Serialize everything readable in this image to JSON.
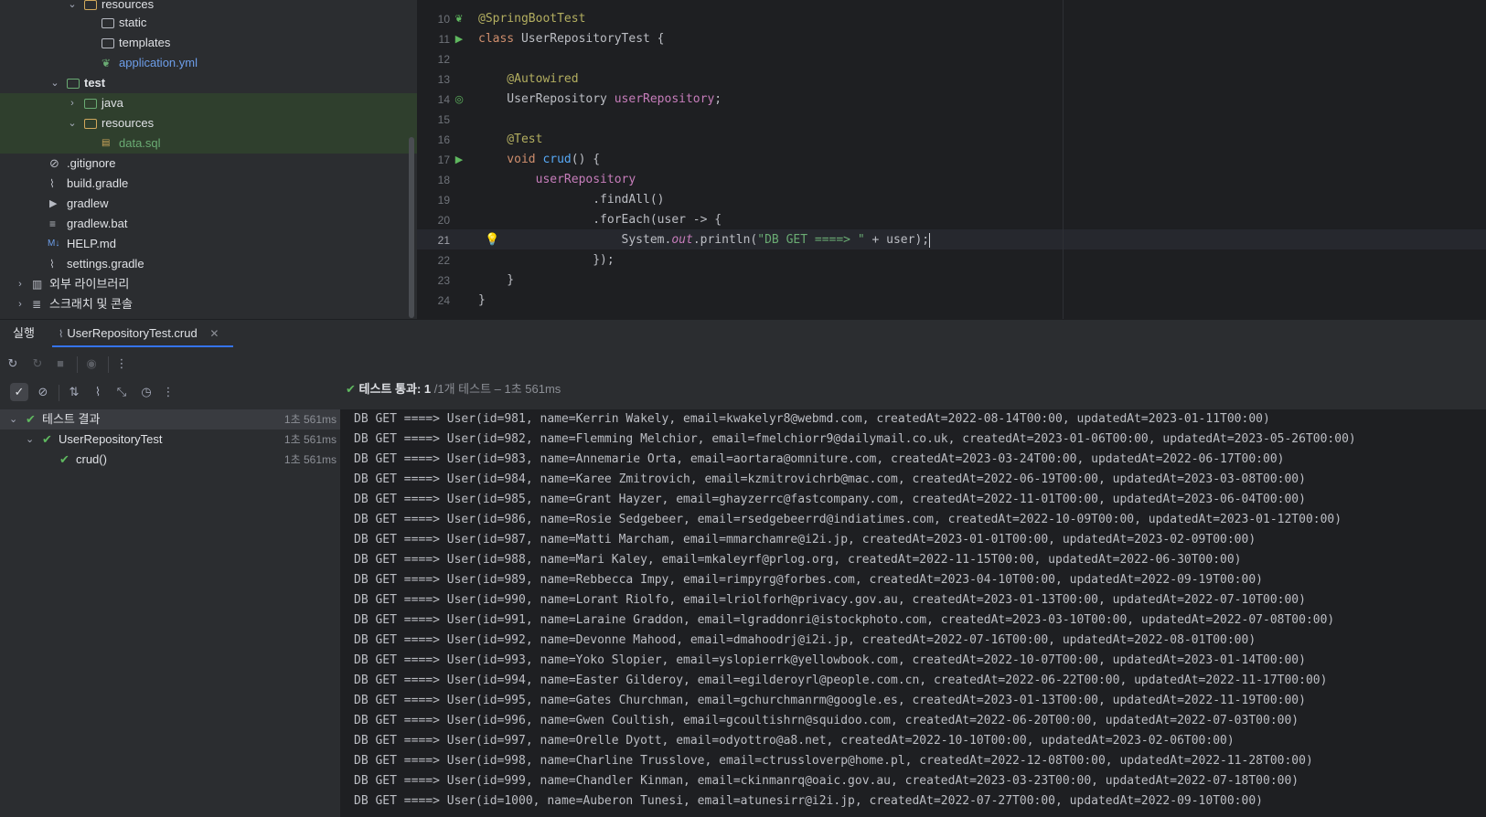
{
  "project_tree": {
    "items": [
      {
        "label": "resources",
        "icon": "resources-folder-icon",
        "arrow": "expanded"
      },
      {
        "label": "static",
        "icon": "folder-icon",
        "arrow": ""
      },
      {
        "label": "templates",
        "icon": "folder-icon",
        "arrow": ""
      },
      {
        "label": "application.yml",
        "icon": "spring-config-file-icon",
        "arrow": ""
      },
      {
        "label": "test",
        "icon": "test-source-folder-icon",
        "arrow": "expanded"
      },
      {
        "label": "java",
        "icon": "folder-icon",
        "arrow": "collapsed"
      },
      {
        "label": "resources",
        "icon": "resources-folder-icon",
        "arrow": "expanded"
      },
      {
        "label": "data.sql",
        "icon": "sql-file-icon",
        "arrow": ""
      },
      {
        "label": ".gitignore",
        "icon": "gitignore-file-icon",
        "arrow": ""
      },
      {
        "label": "build.gradle",
        "icon": "gradle-file-icon",
        "arrow": ""
      },
      {
        "label": "gradlew",
        "icon": "script-file-icon",
        "arrow": ""
      },
      {
        "label": "gradlew.bat",
        "icon": "text-file-icon",
        "arrow": ""
      },
      {
        "label": "HELP.md",
        "icon": "markdown-file-icon",
        "arrow": ""
      },
      {
        "label": "settings.gradle",
        "icon": "gradle-file-icon",
        "arrow": ""
      },
      {
        "label": "외부 라이브러리",
        "icon": "library-icon",
        "arrow": "collapsed"
      },
      {
        "label": "스크래치 및 콘솔",
        "icon": "scratches-icon",
        "arrow": "collapsed"
      }
    ]
  },
  "editor": {
    "line_numbers": [
      "10",
      "11",
      "12",
      "13",
      "14",
      "15",
      "16",
      "17",
      "18",
      "19",
      "20",
      "21",
      "22",
      "23",
      "24"
    ],
    "code": {
      "l10": "@SpringBootTest",
      "l11_kw": "class",
      "l11_rest": " UserRepositoryTest {",
      "l13": "    @Autowired",
      "l14_type": "    UserRepository ",
      "l14_field": "userRepository",
      "l14_end": ";",
      "l16": "    @Test",
      "l17_kw": "    void",
      "l17_fn": " crud",
      "l17_rest": "() {",
      "l18": "        userRepository",
      "l19": "                .findAll()",
      "l20": "                .forEach(user -> {",
      "l21_a": "                    System.",
      "l21_out": "out",
      "l21_b": ".println(",
      "l21_str": "\"DB GET ====> \"",
      "l21_c": " + user);",
      "l22": "                });",
      "l23": "    }",
      "l24": "}"
    }
  },
  "run_window": {
    "tab_run": "실행",
    "tab_config": "UserRepositoryTest.crud",
    "status_pass": "테스트 통과: 1",
    "status_rest": " /1개 테스트 – 1초 561ms",
    "results": [
      {
        "label": "테스트 결과",
        "duration": "1초 561ms"
      },
      {
        "label": "UserRepositoryTest",
        "duration": "1초 561ms"
      },
      {
        "label": "crud()",
        "duration": "1초 561ms"
      }
    ],
    "console": [
      "DB GET ====> User(id=981, name=Kerrin Wakely, email=kwakelyr8@webmd.com, createdAt=2022-08-14T00:00, updatedAt=2023-01-11T00:00)",
      "DB GET ====> User(id=982, name=Flemming Melchior, email=fmelchiorr9@dailymail.co.uk, createdAt=2023-01-06T00:00, updatedAt=2023-05-26T00:00)",
      "DB GET ====> User(id=983, name=Annemarie Orta, email=aortara@omniture.com, createdAt=2023-03-24T00:00, updatedAt=2022-06-17T00:00)",
      "DB GET ====> User(id=984, name=Karee Zmitrovich, email=kzmitrovichrb@mac.com, createdAt=2022-06-19T00:00, updatedAt=2023-03-08T00:00)",
      "DB GET ====> User(id=985, name=Grant Hayzer, email=ghayzerrc@fastcompany.com, createdAt=2022-11-01T00:00, updatedAt=2023-06-04T00:00)",
      "DB GET ====> User(id=986, name=Rosie Sedgebeer, email=rsedgebeerrd@indiatimes.com, createdAt=2022-10-09T00:00, updatedAt=2023-01-12T00:00)",
      "DB GET ====> User(id=987, name=Matti Marcham, email=mmarchamre@i2i.jp, createdAt=2023-01-01T00:00, updatedAt=2023-02-09T00:00)",
      "DB GET ====> User(id=988, name=Mari Kaley, email=mkaleyrf@prlog.org, createdAt=2022-11-15T00:00, updatedAt=2022-06-30T00:00)",
      "DB GET ====> User(id=989, name=Rebbecca Impy, email=rimpyrg@forbes.com, createdAt=2023-04-10T00:00, updatedAt=2022-09-19T00:00)",
      "DB GET ====> User(id=990, name=Lorant Riolfo, email=lriolforh@privacy.gov.au, createdAt=2023-01-13T00:00, updatedAt=2022-07-10T00:00)",
      "DB GET ====> User(id=991, name=Laraine Graddon, email=lgraddonri@istockphoto.com, createdAt=2023-03-10T00:00, updatedAt=2022-07-08T00:00)",
      "DB GET ====> User(id=992, name=Devonne Mahood, email=dmahoodrj@i2i.jp, createdAt=2022-07-16T00:00, updatedAt=2022-08-01T00:00)",
      "DB GET ====> User(id=993, name=Yoko Slopier, email=yslopierrk@yellowbook.com, createdAt=2022-10-07T00:00, updatedAt=2023-01-14T00:00)",
      "DB GET ====> User(id=994, name=Easter Gilderoy, email=egilderoyrl@people.com.cn, createdAt=2022-06-22T00:00, updatedAt=2022-11-17T00:00)",
      "DB GET ====> User(id=995, name=Gates Churchman, email=gchurchmanrm@google.es, createdAt=2023-01-13T00:00, updatedAt=2022-11-19T00:00)",
      "DB GET ====> User(id=996, name=Gwen Coultish, email=gcoultishrn@squidoo.com, createdAt=2022-06-20T00:00, updatedAt=2022-07-03T00:00)",
      "DB GET ====> User(id=997, name=Orelle Dyott, email=odyottro@a8.net, createdAt=2022-10-10T00:00, updatedAt=2023-02-06T00:00)",
      "DB GET ====> User(id=998, name=Charline Trusslove, email=ctrussloverp@home.pl, createdAt=2022-12-08T00:00, updatedAt=2022-11-28T00:00)",
      "DB GET ====> User(id=999, name=Chandler Kinman, email=ckinmanrq@oaic.gov.au, createdAt=2023-03-23T00:00, updatedAt=2022-07-18T00:00)",
      "DB GET ====> User(id=1000, name=Auberon Tunesi, email=atunesirr@i2i.jp, createdAt=2022-07-27T00:00, updatedAt=2022-09-10T00:00)"
    ]
  },
  "colors": {
    "pass_green": "#5fb85f",
    "accent_blue": "#3574f0",
    "annotation": "#b3ae60",
    "keyword": "#cf8e6d",
    "string": "#6aab73",
    "field": "#c77dbb"
  }
}
